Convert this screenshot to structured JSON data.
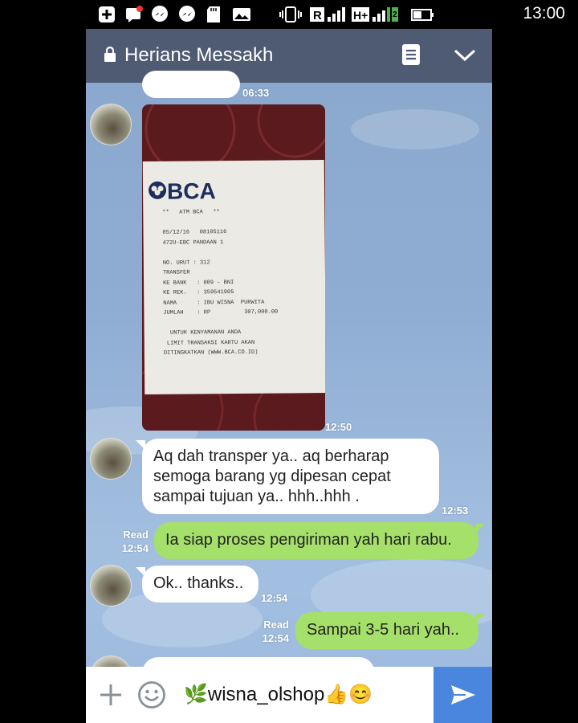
{
  "status_bar": {
    "time": "13:00",
    "icons": [
      "plus-box-icon",
      "notification-icon",
      "messenger-icon",
      "messenger-icon",
      "sd-card-icon",
      "image-icon",
      "vibrate-icon",
      "signal-r-icon",
      "signal-h-icon",
      "battery-icon"
    ]
  },
  "header": {
    "title": "Herians Messakh",
    "lock_icon": "lock-icon",
    "notes_icon": "notes-icon",
    "collapse_icon": "chevron-down-icon"
  },
  "messages": [
    {
      "type": "incoming-partial",
      "time": "06:33"
    },
    {
      "type": "incoming-image",
      "time": "12:50",
      "receipt": {
        "bank": "BCA",
        "lines": [
          "**   ATM BCA   **",
          "",
          "05/12/16   08105116",
          "472U-EBC PANDAAN 1",
          "",
          "NO. URUT : 312",
          "TRANSFER",
          "KE BANK   : 009 - BNI",
          "KE REK.   : 359541905",
          "NAMA      : IBU WISNA  PURWITA",
          "JUMLAH    : RP          307,000.00",
          "",
          "  UNTUK KENYAMANAN ANDA",
          " LIMIT TRANSAKSI KARTU AKAN",
          "DITINGKATKAN (WWW.BCA.CO.ID)"
        ]
      }
    },
    {
      "type": "incoming",
      "text_lines": [
        "Aq dah transper ya.. aq berharap",
        "semoga barang yg dipesan cepat",
        "sampai tujuan ya.. hhh..hhh ."
      ],
      "time": "12:53"
    },
    {
      "type": "outgoing",
      "text": "Ia siap proses pengiriman yah hari rabu.",
      "read": "Read",
      "time": "12:54"
    },
    {
      "type": "incoming",
      "text": "Ok.. thanks..",
      "time": "12:54"
    },
    {
      "type": "outgoing",
      "text": "Sampai 3-5 hari yah..",
      "read": "Read",
      "time": "12:54"
    }
  ],
  "input": {
    "text": "🌿wisna_olshop👍😊",
    "plus_icon": "plus-icon",
    "emoji_icon": "smiley-icon",
    "send_icon": "send-icon"
  },
  "colors": {
    "header": "#4f5b73",
    "outgoing_bubble": "#a5e06a",
    "incoming_bubble": "#ffffff",
    "send_button": "#4a86de"
  }
}
